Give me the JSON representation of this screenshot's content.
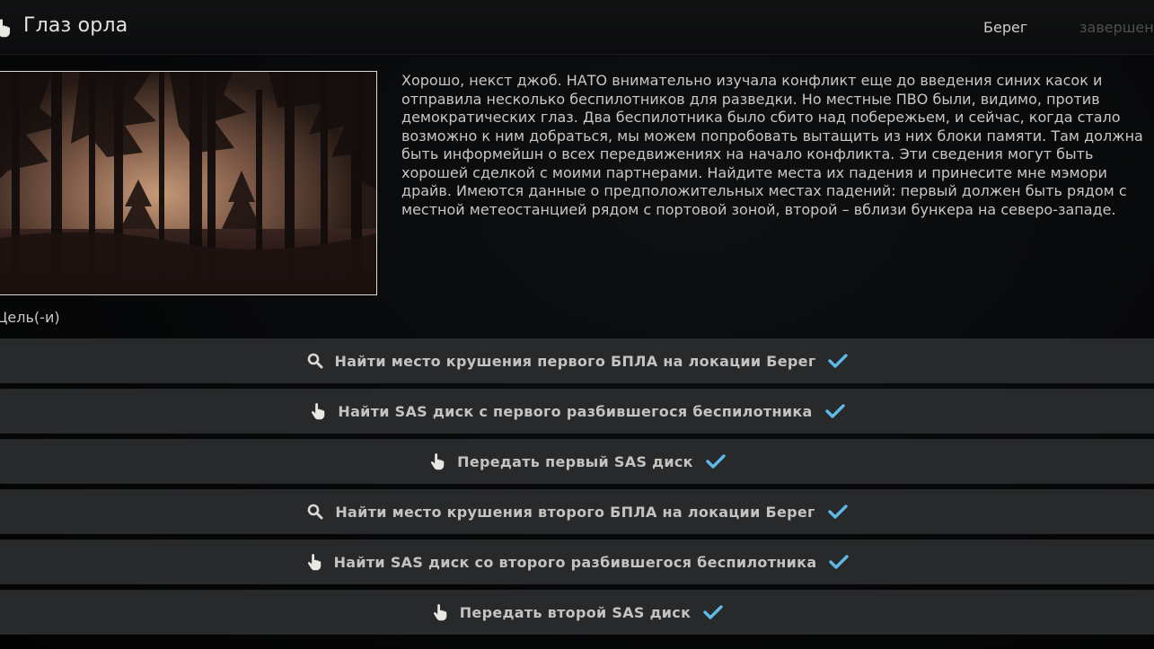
{
  "header": {
    "title": "Глаз орла",
    "location": "Берег",
    "status": "завершен"
  },
  "description": "Хорошо, некст джоб. НАТО внимательно изучала конфликт еще до введения синих касок и отправила несколько беспилотников для разведки. Но местные ПВО были, видимо, против демократических глаз. Два беспилотника было сбито над побережьем, и сейчас, когда стало возможно к ним добраться, мы можем попробовать вытащить из них блоки памяти. Там должна быть информейшн о всех передвижениях на начало конфликта. Эти сведения могут быть хорошей сделкой с моими партнерами. Найдите места их падения и принесите мне мэмори драйв. Имеются данные о предположительных местах падений: первый должен быть рядом с местной метеостанцией рядом с портовой зоной, второй – вблизи бункера на северо-западе.",
  "objectives_label": "Цель(-и)",
  "objectives": [
    {
      "icon": "search-icon",
      "text": "Найти место крушения первого БПЛА на локации Берег",
      "completed": true
    },
    {
      "icon": "hand-pointer-icon",
      "text": "Найти SAS диск с первого разбившегося беспилотника",
      "completed": true
    },
    {
      "icon": "hand-pointer-icon",
      "text": "Передать первый SAS диск",
      "completed": true
    },
    {
      "icon": "search-icon",
      "text": "Найти место крушения второго БПЛА на локации Берег",
      "completed": true
    },
    {
      "icon": "hand-pointer-icon",
      "text": "Найти SAS диск со второго разбившегося беспилотника",
      "completed": true
    },
    {
      "icon": "hand-pointer-icon",
      "text": "Передать второй SAS диск",
      "completed": true
    }
  ],
  "colors": {
    "check": "#5fb9e6",
    "row_bg": "#27292b",
    "status_muted": "#4d4f50"
  }
}
